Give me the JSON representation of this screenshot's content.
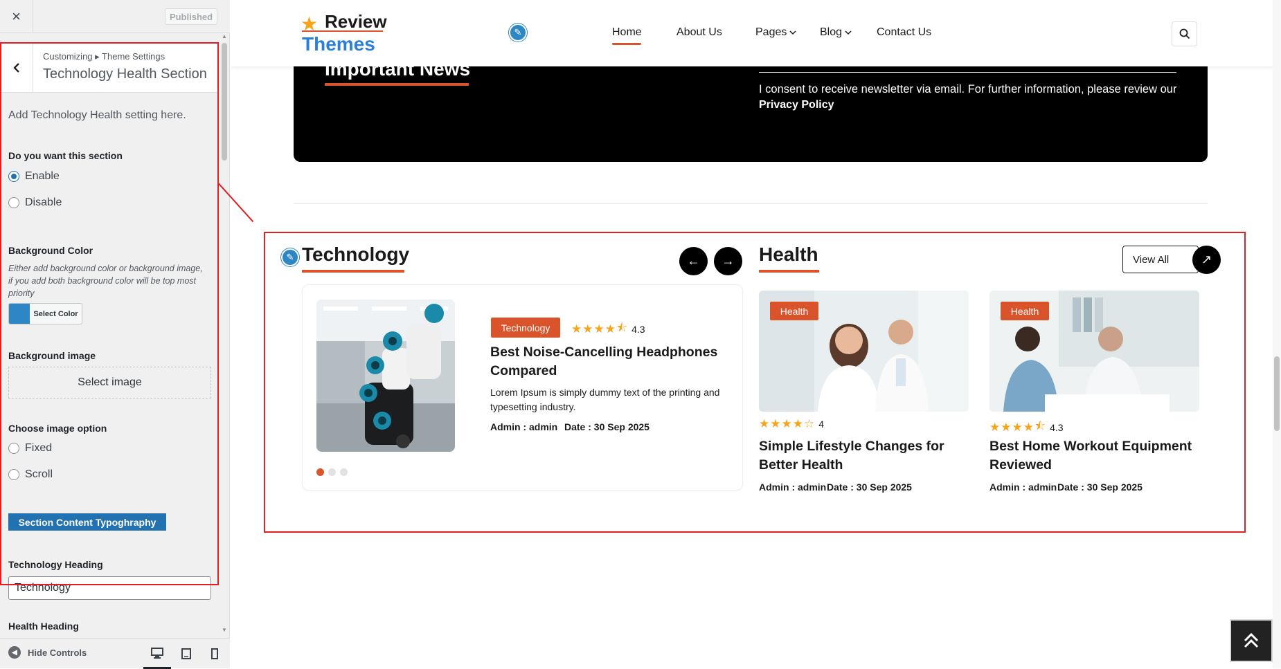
{
  "customizer": {
    "close_label": "×",
    "published_label": "Published",
    "breadcrumb": "Customizing ▸ Theme Settings",
    "section_title": "Technology Health Section",
    "description": "Add Technology Health setting here.",
    "section_toggle": {
      "label": "Do you want this section",
      "options": [
        "Enable",
        "Disable"
      ],
      "selected": "Enable"
    },
    "background_color": {
      "label": "Background Color",
      "description": "Either add background color or background image, if you add both background color will be top most priority",
      "button_label": "Select Color",
      "swatch_color": "#2d87c4"
    },
    "background_image": {
      "label": "Background image",
      "button_label": "Select image"
    },
    "image_option": {
      "label": "Choose image option",
      "options": [
        "Fixed",
        "Scroll"
      ],
      "selected": ""
    },
    "typography_button": "Section Content Typoghraphy",
    "technology_heading": {
      "label": "Technology Heading",
      "value": "Technology"
    },
    "health_heading_label": "Health Heading",
    "hide_controls_label": "Hide Controls",
    "device_icons": [
      "desktop-icon",
      "tablet-icon",
      "mobile-icon"
    ],
    "accent_color": "#2271b1"
  },
  "site": {
    "logo": {
      "line1": "Review",
      "line2": "Themes"
    },
    "nav": {
      "home": "Home",
      "about": "About Us",
      "pages": "Pages",
      "blog": "Blog",
      "contact": "Contact Us"
    },
    "newsletter": {
      "title": "Important News",
      "consent_text": "I consent to receive newsletter via email. For further information, please review our",
      "privacy_link": "Privacy Policy"
    },
    "technology": {
      "heading": "Technology",
      "prev_label": "←",
      "next_label": "→",
      "card": {
        "tag": "Technology",
        "rating": 4.3,
        "rating_text": "4.3",
        "title": "Best Noise-Cancelling Headphones Compared",
        "description": "Lorem Ipsum is simply dummy text of the printing and typesetting industry.",
        "author": "Admin : admin",
        "date": "Date : 30 Sep 2025"
      },
      "slider_dots": 3,
      "active_dot": 0
    },
    "health": {
      "heading": "Health",
      "view_all_label": "View All",
      "posts": [
        {
          "tag": "Health",
          "rating": 4,
          "rating_text": "4",
          "title": "Simple Lifestyle Changes for Better Health",
          "author": "Admin : admin",
          "date": "Date : 30 Sep 2025"
        },
        {
          "tag": "Health",
          "rating": 4.3,
          "rating_text": "4.3",
          "title": "Best Home Workout Equipment Reviewed",
          "author": "Admin : admin",
          "date": "Date : 30 Sep 2025"
        }
      ]
    },
    "colors": {
      "brand_orange": "#d9542b",
      "brand_blue": "#2d7fd6",
      "star": "#f7a41a",
      "highlight_red": "#e01e23"
    }
  }
}
